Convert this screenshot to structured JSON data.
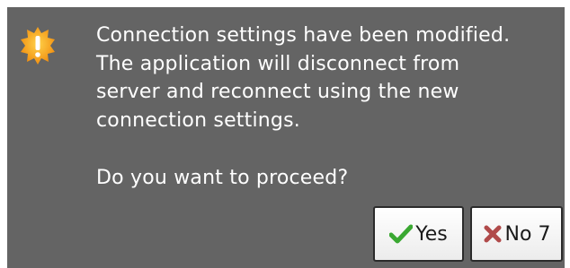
{
  "dialog": {
    "icon": "warning-icon",
    "message_lines": [
      "Connection settings have been modified.",
      "The application will disconnect from",
      "server and reconnect using the new",
      "connection settings."
    ],
    "question": "Do you want to proceed?",
    "buttons": {
      "yes": {
        "label": "Yes",
        "icon": "check-icon"
      },
      "no": {
        "label": "No 7",
        "icon": "x-icon"
      }
    },
    "colors": {
      "background": "#646464",
      "text": "#ffffff",
      "warning": "#f5a623",
      "check": "#3aa832",
      "x": "#b04a4a"
    }
  }
}
